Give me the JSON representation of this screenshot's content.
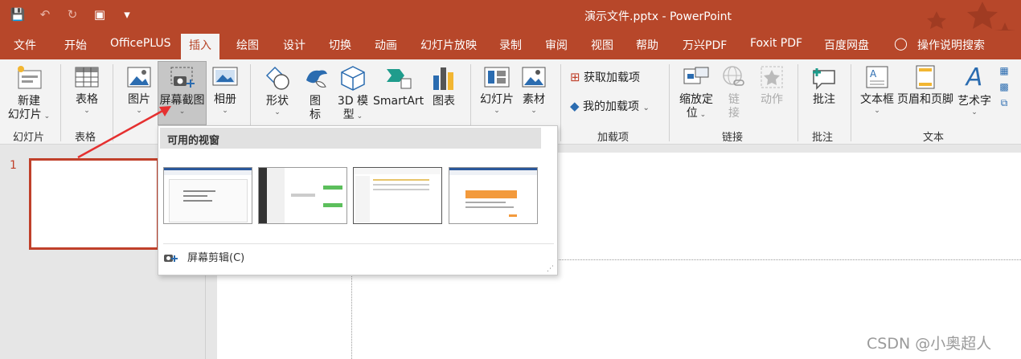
{
  "title_bar": {
    "doc_title": "演示文件.pptx  -  PowerPoint"
  },
  "menu": {
    "file": "文件",
    "home": "开始",
    "officeplus": "OfficePLUS",
    "insert": "插入",
    "draw": "绘图",
    "design": "设计",
    "transitions": "切换",
    "animations": "动画",
    "slideshow": "幻灯片放映",
    "record": "录制",
    "review": "审阅",
    "view": "视图",
    "help": "帮助",
    "wanxing": "万兴PDF",
    "foxit": "Foxit PDF",
    "baidu": "百度网盘",
    "tell_me": "操作说明搜索"
  },
  "ribbon": {
    "new_slide": "新建",
    "new_slide_2": "幻灯片",
    "table": "表格",
    "picture": "图片",
    "screenshot": "屏幕截图",
    "album": "相册",
    "shapes": "形状",
    "icons": "图",
    "icons_2": "标",
    "model3d": "3D 模",
    "model3d_2": "型",
    "smartart": "SmartArt",
    "chart": "图表",
    "slide_lib": "幻灯片",
    "material": "素材",
    "get_addins": "获取加载项",
    "my_addins": "我的加载项",
    "zoom": "缩放定",
    "zoom_2": "位",
    "link": "链",
    "link_2": "接",
    "action": "动作",
    "comment": "批注",
    "textbox": "文本框",
    "header_footer": "页眉和页脚",
    "wordart": "艺术字",
    "groups": {
      "slides": "幻灯片",
      "tables": "表格",
      "addins": "加载项",
      "links": "链接",
      "comments": "批注",
      "text": "文本"
    }
  },
  "dropdown": {
    "header": "可用的视窗",
    "clip_label": "屏幕剪辑(C)"
  },
  "slide_panel": {
    "slide_number": "1"
  },
  "watermark": "CSDN @小奥超人",
  "colors": {
    "accent": "#b7472a",
    "ribbon_bg": "#f3f3f3"
  }
}
